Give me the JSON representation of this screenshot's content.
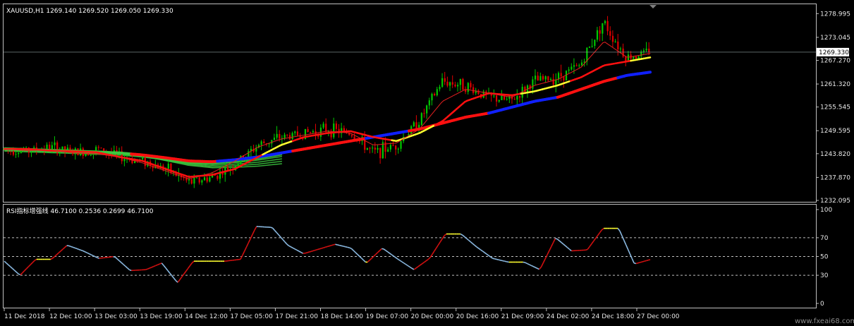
{
  "main_panel": {
    "header": "XAUUSD,H1  1269.140 1269.520 1269.050 1269.330",
    "price_ticks": [
      "1278.995",
      "1273.045",
      "1267.270",
      "1261.320",
      "1255.545",
      "1249.595",
      "1243.820",
      "1237.870",
      "1232.095"
    ],
    "current_price": "1269.330"
  },
  "rsi_panel": {
    "header": "RSI指标增强线 46.7100 0.2536 0.2699 46.7100",
    "ticks": [
      "100",
      "70",
      "50",
      "30",
      "0"
    ]
  },
  "time_ticks": [
    "11 Dec 2018",
    "12 Dec 10:00",
    "13 Dec 03:00",
    "13 Dec 19:00",
    "14 Dec 12:00",
    "17 Dec 05:00",
    "17 Dec 21:00",
    "18 Dec 14:00",
    "19 Dec 07:00",
    "20 Dec 00:00",
    "20 Dec 16:00",
    "21 Dec 09:00",
    "24 Dec 02:00",
    "24 Dec 18:00",
    "27 Dec 00:00"
  ],
  "watermark": "www.fxeai68.com",
  "colors": {
    "background": "#000000",
    "grid": "#c0c0c0",
    "bull": "#00c800",
    "bear": "#e00000",
    "ma_slow_up": "#ff1010",
    "ma_slow_down": "#1020ff",
    "ma_mid": "#ffff30",
    "ma_fast": "#e02020",
    "rsi_up": "#d01010",
    "rsi_down": "#8ab8e0",
    "rsi_flat": "#ffff30",
    "ribbon": "#3cc840"
  },
  "chart_data": [
    {
      "type": "candlestick",
      "title": "XAUUSD,H1",
      "ohlc_last": {
        "open": 1269.14,
        "high": 1269.52,
        "low": 1269.05,
        "close": 1269.33
      },
      "ylim": [
        1232.095,
        1281.0
      ],
      "x": [
        "11 Dec 2018",
        "12 Dec 10:00",
        "13 Dec 03:00",
        "13 Dec 19:00",
        "14 Dec 12:00",
        "17 Dec 05:00",
        "17 Dec 21:00",
        "18 Dec 14:00",
        "19 Dec 07:00",
        "20 Dec 00:00",
        "20 Dec 16:00",
        "21 Dec 09:00",
        "24 Dec 02:00",
        "24 Dec 18:00",
        "27 Dec 00:00"
      ],
      "close_path": [
        1245,
        1244.5,
        1245.5,
        1244,
        1245,
        1243,
        1242,
        1240,
        1236.5,
        1238,
        1241,
        1246,
        1248,
        1249,
        1250,
        1249,
        1244,
        1246,
        1252,
        1262,
        1261,
        1258,
        1257,
        1262,
        1263,
        1266,
        1277,
        1268,
        1269.33
      ],
      "series": [
        {
          "name": "",
          "kind": "slow MA",
          "values": [
            1245,
            1244.8,
            1244.6,
            1244.4,
            1244.2,
            1244,
            1243.5,
            1242.8,
            1242,
            1241.8,
            1242.3,
            1243,
            1244,
            1245,
            1246,
            1247,
            1248,
            1249,
            1250,
            1251.5,
            1253,
            1254,
            1255.5,
            1257,
            1258,
            1260,
            1262,
            1263.5,
            1264.3
          ]
        },
        {
          "name": "",
          "kind": "mid MA",
          "values": [
            1245,
            1245,
            1244.6,
            1244.4,
            1244.2,
            1243,
            1242,
            1240,
            1238,
            1238.5,
            1240,
            1243,
            1246,
            1248,
            1249,
            1249.5,
            1248,
            1247,
            1249,
            1252,
            1257,
            1259,
            1258.5,
            1259.5,
            1261,
            1263,
            1266,
            1267,
            1268
          ]
        },
        {
          "name": "",
          "kind": "fast MA",
          "values": [
            1245,
            1244.6,
            1244.8,
            1244,
            1243.8,
            1243,
            1241.5,
            1239.5,
            1237.5,
            1239,
            1242,
            1245.5,
            1247.5,
            1248.5,
            1249.5,
            1249,
            1246,
            1246.5,
            1250,
            1257,
            1260,
            1259,
            1258,
            1261,
            1262.5,
            1265.5,
            1272,
            1268,
            1269
          ]
        }
      ]
    },
    {
      "type": "line",
      "title": "RSI指标增强线",
      "ylim": [
        0,
        100
      ],
      "levels": [
        30,
        50,
        70
      ],
      "series": [
        {
          "name": "",
          "values": [
            45,
            30,
            47,
            47,
            62,
            56,
            48,
            50,
            35,
            36,
            43,
            22,
            45,
            45,
            45,
            47,
            82,
            81,
            62,
            53,
            58,
            63,
            59,
            43,
            59,
            47,
            36,
            48,
            74,
            74,
            60,
            48,
            44,
            44,
            36,
            70,
            56,
            57,
            80,
            80,
            42,
            46.71
          ]
        }
      ]
    }
  ]
}
